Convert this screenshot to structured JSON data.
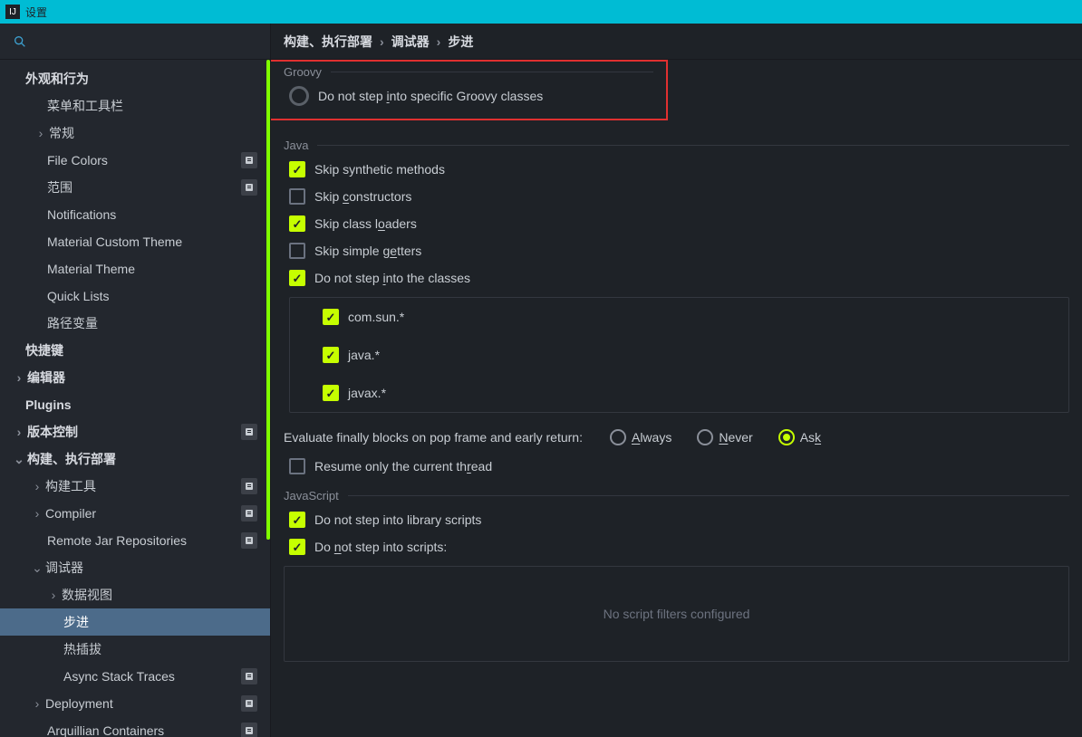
{
  "titlebar": {
    "title": "设置"
  },
  "sidebar": {
    "items": [
      {
        "label": "外观和行为",
        "indent": 28,
        "chev": false,
        "bold": true,
        "badge": false
      },
      {
        "label": "菜单和工具栏",
        "indent": 52,
        "chev": false,
        "bold": false,
        "badge": false
      },
      {
        "label": "常规",
        "indent": 52,
        "chev": true,
        "chevDir": "right",
        "bold": false,
        "badge": false
      },
      {
        "label": "File Colors",
        "indent": 52,
        "chev": false,
        "bold": false,
        "badge": true
      },
      {
        "label": "范围",
        "indent": 52,
        "chev": false,
        "bold": false,
        "badge": true
      },
      {
        "label": "Notifications",
        "indent": 52,
        "chev": false,
        "bold": false,
        "badge": false
      },
      {
        "label": "Material Custom Theme",
        "indent": 52,
        "chev": false,
        "bold": false,
        "badge": false
      },
      {
        "label": "Material Theme",
        "indent": 52,
        "chev": false,
        "bold": false,
        "badge": false
      },
      {
        "label": "Quick Lists",
        "indent": 52,
        "chev": false,
        "bold": false,
        "badge": false
      },
      {
        "label": "路径变量",
        "indent": 52,
        "chev": false,
        "bold": false,
        "badge": false
      },
      {
        "label": "快捷键",
        "indent": 28,
        "chev": false,
        "bold": true,
        "badge": false
      },
      {
        "label": "编辑器",
        "indent": 28,
        "chev": true,
        "chevDir": "right",
        "bold": true,
        "badge": false
      },
      {
        "label": "Plugins",
        "indent": 28,
        "chev": false,
        "bold": true,
        "badge": false
      },
      {
        "label": "版本控制",
        "indent": 28,
        "chev": true,
        "chevDir": "right",
        "bold": true,
        "badge": true
      },
      {
        "label": "构建、执行部署",
        "indent": 28,
        "chev": true,
        "chevDir": "down",
        "bold": true,
        "badge": false
      },
      {
        "label": "构建工具",
        "indent": 48,
        "chev": true,
        "chevDir": "right",
        "bold": false,
        "badge": true
      },
      {
        "label": "Compiler",
        "indent": 48,
        "chev": true,
        "chevDir": "right",
        "bold": false,
        "badge": true
      },
      {
        "label": "Remote Jar Repositories",
        "indent": 52,
        "chev": false,
        "bold": false,
        "badge": true
      },
      {
        "label": "调试器",
        "indent": 48,
        "chev": true,
        "chevDir": "down",
        "bold": false,
        "badge": false
      },
      {
        "label": "数据视图",
        "indent": 66,
        "chev": true,
        "chevDir": "right",
        "bold": false,
        "badge": false
      },
      {
        "label": "步进",
        "indent": 70,
        "chev": false,
        "bold": false,
        "badge": false,
        "selected": true
      },
      {
        "label": "热插拔",
        "indent": 70,
        "chev": false,
        "bold": false,
        "badge": false
      },
      {
        "label": "Async Stack Traces",
        "indent": 70,
        "chev": false,
        "bold": false,
        "badge": true
      },
      {
        "label": "Deployment",
        "indent": 48,
        "chev": true,
        "chevDir": "right",
        "bold": false,
        "badge": true
      },
      {
        "label": "Arquillian Containers",
        "indent": 52,
        "chev": false,
        "bold": false,
        "badge": true
      }
    ]
  },
  "breadcrumb": [
    "构建、执行部署",
    "调试器",
    "步进"
  ],
  "groovy": {
    "title": "Groovy",
    "opt1_pre": "Do not step ",
    "opt1_u": "i",
    "opt1_post": "nto specific Groovy classes"
  },
  "java": {
    "title": "Java",
    "skip_synth": "Skip synthetic methods",
    "skip_ctor_pre": "Skip ",
    "skip_ctor_u": "c",
    "skip_ctor_post": "onstructors",
    "skip_load_pre": "Skip class l",
    "skip_load_u": "o",
    "skip_load_post": "aders",
    "skip_get_pre": "Skip simple g",
    "skip_get_u": "e",
    "skip_get_post": "tters",
    "noclass_pre": "Do not step ",
    "noclass_u": "i",
    "noclass_post": "nto the classes",
    "classes": [
      "com.sun.*",
      "java.*",
      "javax.*"
    ],
    "eval_label": "Evaluate finally blocks on pop frame and early return:",
    "radio_always_u": "A",
    "radio_always_post": "lways",
    "radio_never_u": "N",
    "radio_never_post": "ever",
    "radio_ask_pre": "As",
    "radio_ask_u": "k",
    "resume_pre": "Resume only the current th",
    "resume_u": "r",
    "resume_post": "ead"
  },
  "js": {
    "title": "JavaScript",
    "opt1": "Do not step into library scripts",
    "opt2_pre": "Do ",
    "opt2_u": "n",
    "opt2_post": "ot step into scripts:",
    "empty": "No script filters configured"
  }
}
